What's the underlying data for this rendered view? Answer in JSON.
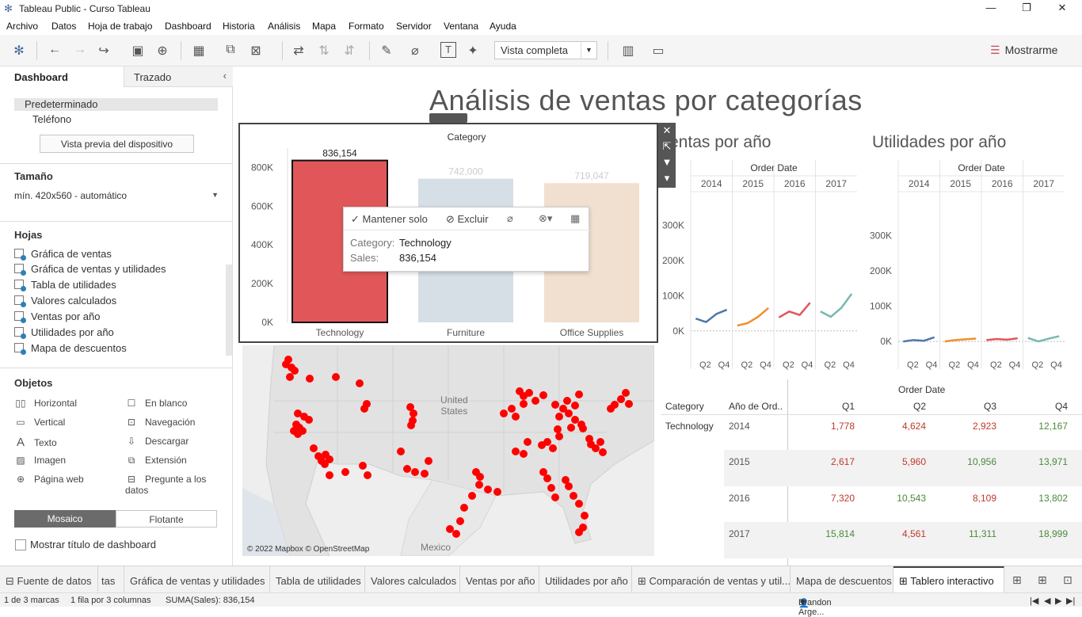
{
  "window": {
    "title": "Tableau Public - Curso Tableau"
  },
  "menu": [
    "Archivo",
    "Datos",
    "Hoja de trabajo",
    "Dashboard",
    "Historia",
    "Análisis",
    "Mapa",
    "Formato",
    "Servidor",
    "Ventana",
    "Ayuda"
  ],
  "toolbar": {
    "view_mode": "Vista completa",
    "show_me": "Mostrarme"
  },
  "sidebar": {
    "tab_dashboard": "Dashboard",
    "tab_layout": "Trazado",
    "device_default": "Predeterminado",
    "device_phone": "Teléfono",
    "preview_button": "Vista previa del dispositivo",
    "size_heading": "Tamaño",
    "size_value": "mín. 420x560 - automático",
    "sheets_heading": "Hojas",
    "sheets": [
      "Gráfica de ventas",
      "Gráfica de ventas y utilidades",
      "Tabla de utilidades",
      "Valores calculados",
      "Ventas por año",
      "Utilidades por año",
      "Mapa de descuentos"
    ],
    "objects_heading": "Objetos",
    "objects_left": [
      {
        "label": "Horizontal",
        "icon": "horizontal-container-icon"
      },
      {
        "label": "Vertical",
        "icon": "vertical-container-icon"
      },
      {
        "label": "Texto",
        "icon": "text-icon"
      },
      {
        "label": "Imagen",
        "icon": "image-icon"
      },
      {
        "label": "Página web",
        "icon": "globe-icon"
      }
    ],
    "objects_right": [
      {
        "label": "En blanco",
        "icon": "blank-icon"
      },
      {
        "label": "Navegación",
        "icon": "navigation-icon"
      },
      {
        "label": "Descargar",
        "icon": "download-icon"
      },
      {
        "label": "Extensión",
        "icon": "extension-icon"
      },
      {
        "label": "Pregunte a los datos",
        "icon": "ask-data-icon"
      }
    ],
    "mosaic": "Mosaico",
    "floating": "Flotante",
    "show_title": "Mostrar título de dashboard"
  },
  "dashboard": {
    "title": "Análisis de ventas por categorías",
    "sales_by_year_title": "Ventas por año",
    "sales_by_year_visible": "entas por año",
    "profit_by_year_title": "Utilidades por año",
    "order_date": "Order Date"
  },
  "chart_data": [
    {
      "type": "bar",
      "title": "Category",
      "categories": [
        "Technology",
        "Furniture",
        "Office Supplies"
      ],
      "values": [
        836154,
        742000,
        719047
      ],
      "data_labels": [
        "836,154",
        "742,000",
        "719,047"
      ],
      "y_ticks": [
        "0K",
        "200K",
        "400K",
        "600K",
        "800K"
      ],
      "ylim": [
        0,
        900000
      ],
      "colors": [
        "#e15759",
        "#d6dee6",
        "#f1e0cf"
      ],
      "selected": "Technology"
    },
    {
      "type": "line",
      "title": "Ventas por año",
      "years": [
        "2014",
        "2015",
        "2016",
        "2017"
      ],
      "x_ticks": [
        "Q2",
        "Q4"
      ],
      "y_ticks": [
        "0K",
        "100K",
        "200K",
        "300K"
      ],
      "ylim": [
        -50000,
        350000
      ],
      "series": [
        {
          "color": "#4e79a7",
          "values": [
            [
              35000,
              25000,
              48000,
              60000
            ]
          ]
        },
        {
          "color": "#f28e2b",
          "values": [
            [
              15000,
              22000,
              40000,
              65000
            ]
          ]
        },
        {
          "color": "#e15759",
          "values": [
            [
              38000,
              55000,
              45000,
              80000
            ]
          ]
        },
        {
          "color": "#76b7b2",
          "values": [
            [
              55000,
              40000,
              65000,
              105000
            ]
          ]
        }
      ]
    },
    {
      "type": "line",
      "title": "Utilidades por año",
      "years": [
        "2014",
        "2015",
        "2016",
        "2017"
      ],
      "x_ticks": [
        "Q2",
        "Q4"
      ],
      "y_ticks": [
        "0K",
        "100K",
        "200K",
        "300K"
      ],
      "ylim": [
        -20000,
        380000
      ],
      "series": [
        {
          "color": "#4e79a7",
          "values": [
            [
              0,
              4000,
              2000,
              12000
            ]
          ]
        },
        {
          "color": "#f28e2b",
          "values": [
            [
              0,
              4000,
              6000,
              8000
            ]
          ]
        },
        {
          "color": "#e15759",
          "values": [
            [
              4000,
              7000,
              5000,
              9000
            ]
          ]
        },
        {
          "color": "#76b7b2",
          "values": [
            [
              10000,
              0,
              8000,
              15000
            ]
          ]
        }
      ]
    },
    {
      "type": "table",
      "title": "Order Date",
      "columns": [
        "Category",
        "Año de Ord..",
        "Q1",
        "Q2",
        "Q3",
        "Q4"
      ],
      "rows": [
        {
          "category": "Technology",
          "year": "2014",
          "values": [
            "1,778",
            "4,624",
            "2,923",
            "12,167"
          ]
        },
        {
          "category": "",
          "year": "2015",
          "values": [
            "2,617",
            "5,960",
            "10,956",
            "13,971"
          ]
        },
        {
          "category": "",
          "year": "2016",
          "values": [
            "7,320",
            "10,543",
            "8,109",
            "13,802"
          ]
        },
        {
          "category": "",
          "year": "2017",
          "values": [
            "15,814",
            "4,561",
            "11,311",
            "18,999"
          ]
        }
      ],
      "cell_colors": [
        [
          "#c0392b",
          "#c0392b",
          "#c0392b",
          "#4a8a3a"
        ],
        [
          "#c0392b",
          "#c0392b",
          "#4a8a3a",
          "#4a8a3a"
        ],
        [
          "#c0392b",
          "#4a8a3a",
          "#c0392b",
          "#4a8a3a"
        ],
        [
          "#4a8a3a",
          "#c0392b",
          "#4a8a3a",
          "#4a8a3a"
        ]
      ]
    }
  ],
  "tooltip": {
    "keep_only": "Mantener solo",
    "exclude": "Excluir",
    "category_key": "Category:",
    "category_value": "Technology",
    "sales_key": "Sales:",
    "sales_value": "836,154"
  },
  "map": {
    "credit": "© 2022 Mapbox © OpenStreetMap",
    "label_us": "United\nStates",
    "label_mx": "Mexico",
    "point_color": "#ff0000"
  },
  "bottom_tabs": [
    {
      "label": "Fuente de datos",
      "icon": "datasource-icon"
    },
    {
      "label": "tas",
      "icon": ""
    },
    {
      "label": "Gráfica de ventas y utilidades",
      "icon": ""
    },
    {
      "label": "Tabla de utilidades",
      "icon": ""
    },
    {
      "label": "Valores calculados",
      "icon": ""
    },
    {
      "label": "Ventas por año",
      "icon": ""
    },
    {
      "label": "Utilidades por año",
      "icon": ""
    },
    {
      "label": "Comparación de ventas y util...",
      "icon": "dashboard-icon"
    },
    {
      "label": "Mapa de descuentos",
      "icon": ""
    },
    {
      "label": "Tablero interactivo",
      "icon": "dashboard-icon"
    }
  ],
  "status": {
    "marks": "1 de 3 marcas",
    "rows_cols": "1 fila por 3 columnas",
    "sum": "SUMA(Sales): 836,154",
    "user": "Brandon Arge..."
  }
}
